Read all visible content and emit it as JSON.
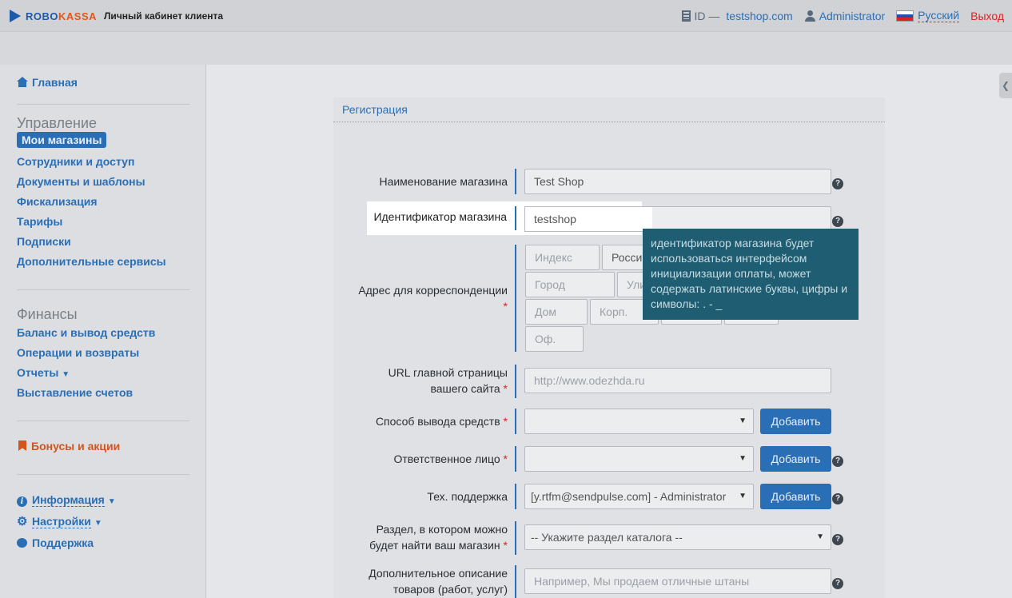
{
  "header": {
    "brand_left": "ROBO",
    "brand_right": "KASSA",
    "subtitle": "Личный кабинет клиента",
    "id_label": "ID —",
    "shop_link": "testshop.com",
    "user": "Administrator",
    "language": "Русский",
    "logout": "Выход"
  },
  "sidebar": {
    "home": "Главная",
    "management_title": "Управление",
    "management_items": [
      "Мои магазины",
      "Сотрудники и доступ",
      "Документы и шаблоны",
      "Фискализация",
      "Тарифы",
      "Подписки",
      "Дополнительные сервисы"
    ],
    "finance_title": "Финансы",
    "finance_items": [
      "Баланс и вывод средств",
      "Операции и возвраты",
      "Отчеты",
      "Выставление счетов"
    ],
    "bonuses": "Бонусы и акции",
    "info": "Информация",
    "settings": "Настройки",
    "support": "Поддержка",
    "caret": "▼"
  },
  "panel": {
    "title": "Регистрация"
  },
  "form": {
    "shop_name": {
      "label": "Наименование магазина",
      "value": "Test Shop"
    },
    "shop_id": {
      "label": "Идентификатор магазина",
      "value": "testshop"
    },
    "address": {
      "label": "Адрес для корреспонденции",
      "index_ph": "Индекс",
      "country": "Росси",
      "city_ph": "Город",
      "street_ph": "Ули",
      "house_ph": "Дом",
      "building_ph": "Корп.",
      "office_ph": "Оф."
    },
    "site_url": {
      "label_1": "URL главной страницы",
      "label_2": "вашего сайта",
      "placeholder": "http://www.odezhda.ru"
    },
    "payout": {
      "label": "Способ вывода средств",
      "add": "Добавить"
    },
    "responsible": {
      "label": "Ответственное лицо",
      "add": "Добавить"
    },
    "support": {
      "label": "Тех. поддержка",
      "value": "[y.rtfm@sendpulse.com] - Administrator",
      "add": "Добавить"
    },
    "catalog": {
      "label_1": "Раздел, в котором можно",
      "label_2": "будет найти ваш магазин",
      "value": "-- Укажите раздел каталога --"
    },
    "description": {
      "label_1": "Дополнительное описание",
      "label_2": "товаров (работ, услуг)",
      "placeholder": "Например, Мы продаем отличные штаны"
    },
    "required_mark": "*",
    "help_mark": "?",
    "select_arrow": "▼"
  },
  "tooltip": {
    "text": "идентификатор магазина будет использоваться интерфейсом инициализации оплаты, может содержать латинские буквы, цифры и символы: . - _"
  },
  "colors": {
    "accent": "#2a6fb5",
    "brand_orange": "#e05a1c",
    "logout": "#dd2222",
    "bonus": "#d2551d",
    "tooltip_bg": "#1f5e72"
  }
}
